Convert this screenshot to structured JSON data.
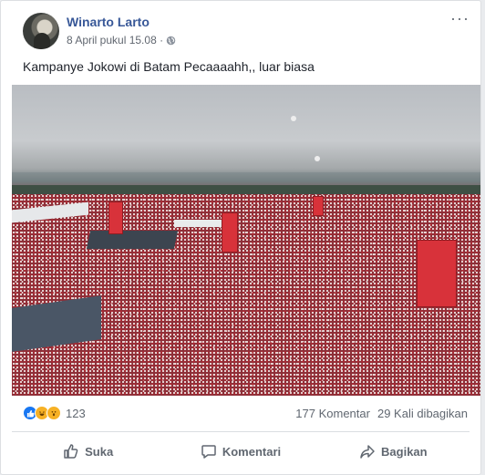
{
  "post": {
    "author": "Winarto Larto",
    "timestamp": "8 April pukul 15.08 ·",
    "text": "Kampanye Jokowi di Batam Pecaaaahh,, luar biasa",
    "privacy_icon": "globe-icon",
    "more_icon": "ellipsis-icon"
  },
  "stats": {
    "reactions": [
      "like",
      "haha",
      "wow"
    ],
    "reaction_count": "123",
    "comments": "177 Komentar",
    "shares": "29 Kali dibagikan"
  },
  "actions": {
    "like_label": "Suka",
    "comment_label": "Komentari",
    "share_label": "Bagikan"
  },
  "colors": {
    "author_link": "#385898",
    "like_blue": "#1877f2",
    "meta_gray": "#616770"
  }
}
